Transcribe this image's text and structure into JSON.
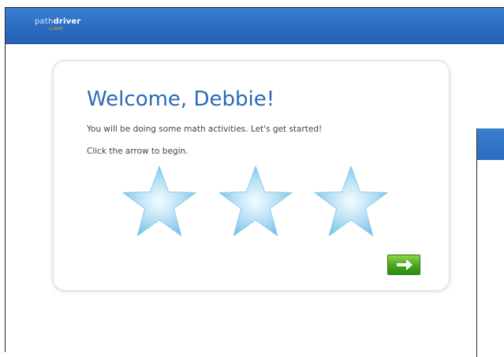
{
  "app": {
    "logo_light": "path",
    "logo_bold": "driver",
    "logo_sub": "by MAPP"
  },
  "welcome": {
    "title": "Welcome, Debbie!",
    "message": "You will be doing some math activities. Let's get started!",
    "instruction": "Click the arrow to begin."
  },
  "stars": [
    "star-icon",
    "star-icon",
    "star-icon"
  ],
  "next": {
    "icon": "arrow-right-icon",
    "color": "#44a51f"
  },
  "colors": {
    "header": "#2b6bbf",
    "title": "#2a6ab8",
    "star": "#9fd4ee"
  }
}
